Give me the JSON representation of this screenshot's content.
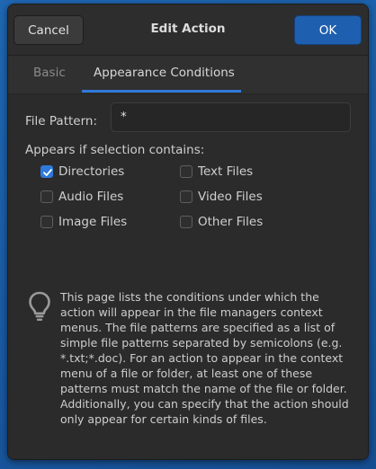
{
  "header": {
    "title": "Edit Action",
    "cancel_label": "Cancel",
    "ok_label": "OK"
  },
  "tabs": [
    {
      "label": "Basic",
      "active": false
    },
    {
      "label": "Appearance Conditions",
      "active": true
    }
  ],
  "file_pattern": {
    "label": "File Pattern:",
    "value": "*"
  },
  "selection": {
    "label": "Appears if selection contains:",
    "options": [
      {
        "label": "Directories",
        "checked": true
      },
      {
        "label": "Text Files",
        "checked": false
      },
      {
        "label": "Audio Files",
        "checked": false
      },
      {
        "label": "Video Files",
        "checked": false
      },
      {
        "label": "Image Files",
        "checked": false
      },
      {
        "label": "Other Files",
        "checked": false
      }
    ]
  },
  "info": {
    "icon": "lightbulb-icon",
    "text": "This page lists the conditions under which the action will appear in the file managers context menus. The file patterns are specified as a list of simple file patterns separated by semicolons (e.g. *.txt;*.doc). For an action to appear in the context menu of a file or folder, at least one of these patterns must match the name of the file or folder. Additionally, you can specify that the action should only appear for certain kinds of files."
  },
  "colors": {
    "accent": "#2f7ad8",
    "ok_button": "#1f5fb0",
    "desktop": "#1a5aa3"
  }
}
